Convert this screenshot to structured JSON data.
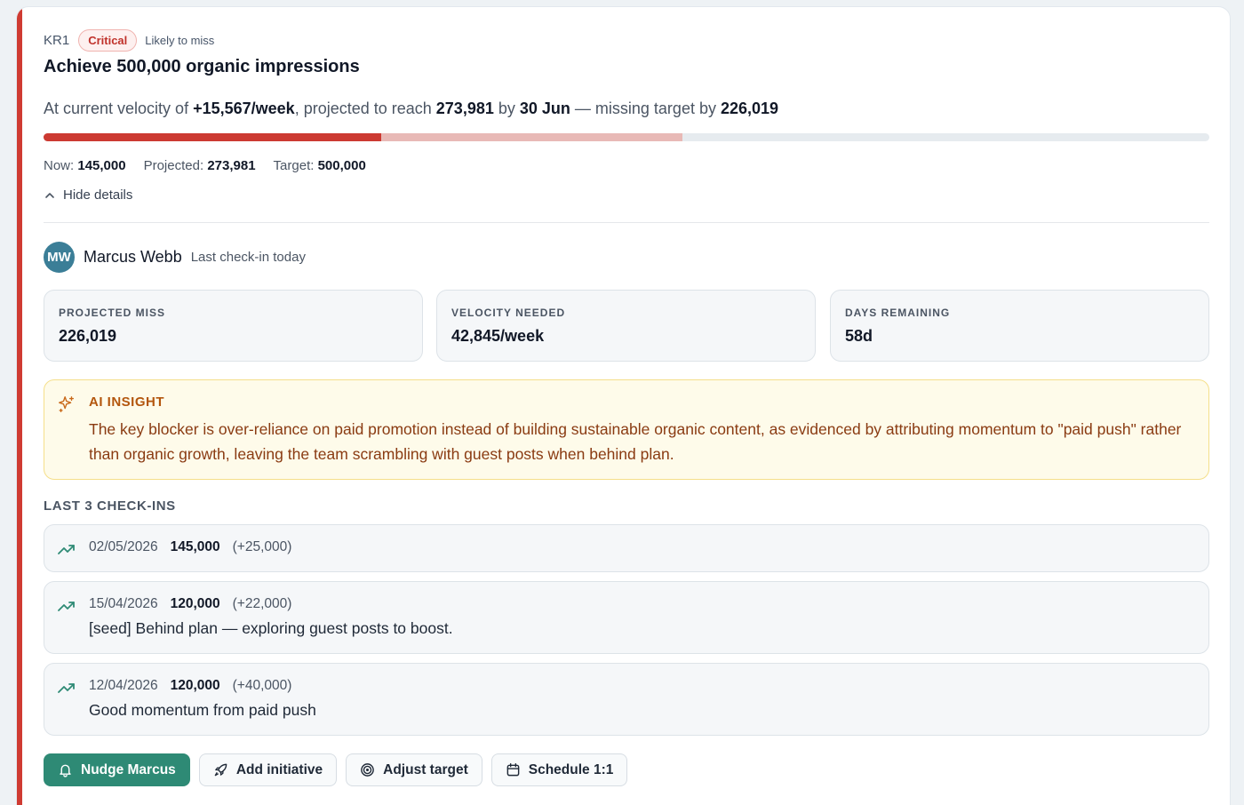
{
  "kr": {
    "id": "KR1",
    "severity": "Critical",
    "risk": "Likely to miss",
    "title": "Achieve 500,000 organic impressions"
  },
  "summary": {
    "prefix": "At current velocity of ",
    "velocity": "+15,567/week",
    "mid": ", projected to reach ",
    "projected": "273,981",
    "by": " by ",
    "date": "30 Jun",
    "suffix": " — missing target by ",
    "miss": "226,019"
  },
  "progress": {
    "now_value": 145000,
    "projected_value": 273981,
    "target_value": 500000,
    "now_label": "Now:",
    "now": "145,000",
    "projected_label": "Projected:",
    "projected": "273,981",
    "target_label": "Target:",
    "target": "500,000"
  },
  "toggle": {
    "label": "Hide details",
    "icon": "chevron-up-icon"
  },
  "owner": {
    "initials": "MW",
    "name": "Marcus Webb",
    "checkin": "Last check-in today",
    "avatar_color": "#3b7e97"
  },
  "metrics": [
    {
      "label": "PROJECTED MISS",
      "value": "226,019"
    },
    {
      "label": "VELOCITY NEEDED",
      "value": "42,845/week"
    },
    {
      "label": "DAYS REMAINING",
      "value": "58d"
    }
  ],
  "insight": {
    "label": "AI INSIGHT",
    "icon": "sparkles-icon",
    "text": "The key blocker is over-reliance on paid promotion instead of building sustainable organic content, as evidenced by attributing momentum to \"paid push\" rather than organic growth, leaving the team scrambling with guest posts when behind plan."
  },
  "checkins": {
    "label": "LAST 3 CHECK-INS",
    "items": [
      {
        "date": "02/05/2026",
        "value": "145,000",
        "delta": "(+25,000)",
        "note": "",
        "icon": "trending-up-icon"
      },
      {
        "date": "15/04/2026",
        "value": "120,000",
        "delta": "(+22,000)",
        "note": "[seed] Behind plan — exploring guest posts to boost.",
        "icon": "trending-up-icon"
      },
      {
        "date": "12/04/2026",
        "value": "120,000",
        "delta": "(+40,000)",
        "note": "Good momentum from paid push",
        "icon": "trending-up-icon"
      }
    ]
  },
  "actions": [
    {
      "label": "Nudge Marcus",
      "icon": "bell-icon"
    },
    {
      "label": "Add initiative",
      "icon": "rocket-icon"
    },
    {
      "label": "Adjust target",
      "icon": "target-icon"
    },
    {
      "label": "Schedule 1:1",
      "icon": "calendar-icon"
    }
  ],
  "colors": {
    "critical": "#cc3a32",
    "projected_fill": "#e8b9b6",
    "track": "#e6ebef",
    "primary_button": "#2e8a75",
    "trend_up": "#2e8a75",
    "insight_bg": "#fefbea",
    "insight_text": "#8a3b12"
  }
}
